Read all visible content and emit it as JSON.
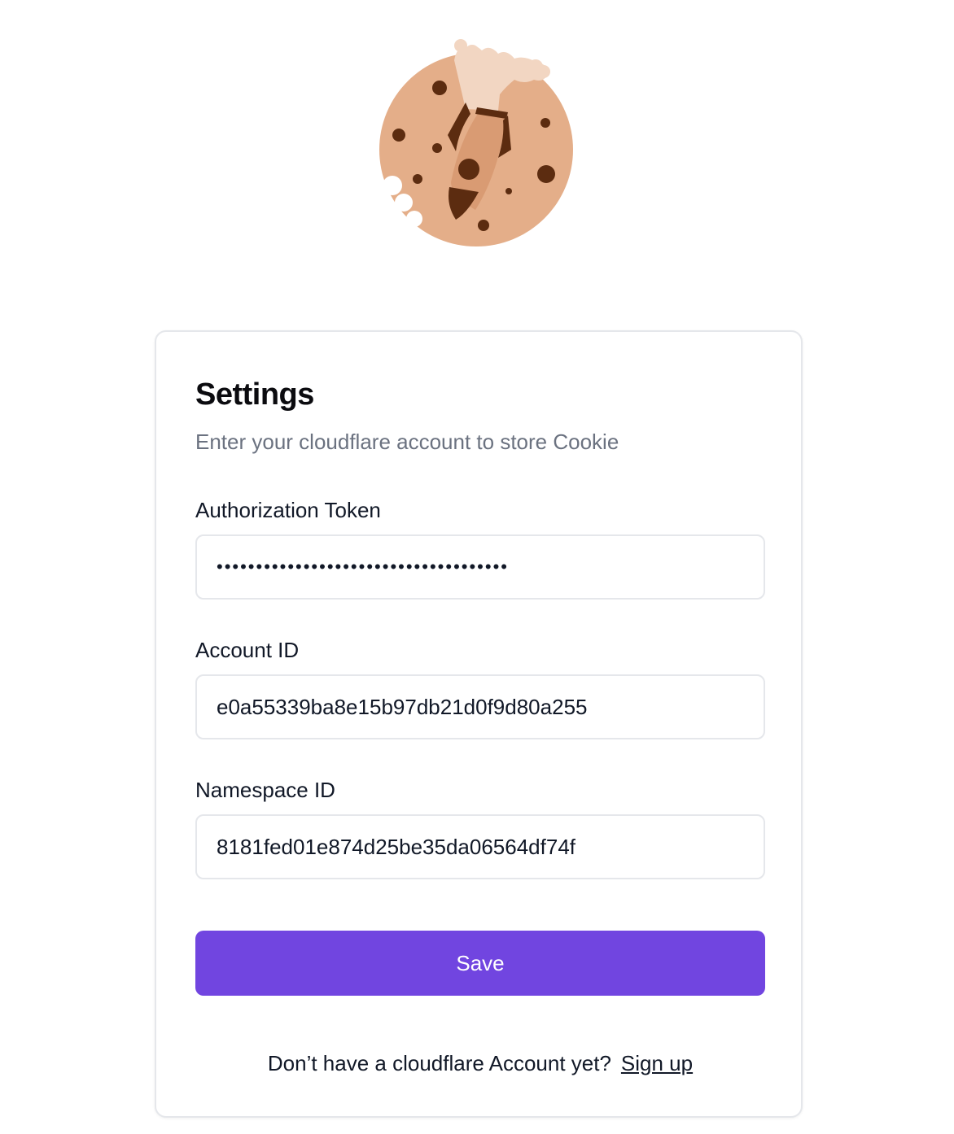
{
  "logo": {
    "icon": "cookie-rocket-logo",
    "colors": {
      "dough": "#e4ae89",
      "chip": "#5c2c10",
      "smoke": "#f2d6c2"
    }
  },
  "settings": {
    "title": "Settings",
    "subtitle": "Enter your cloudflare account to store Cookie",
    "authorization_token": {
      "label": "Authorization Token",
      "value": "•••••••••••••••••••••••••••••••••••••"
    },
    "account_id": {
      "label": "Account ID",
      "value": "e0a55339ba8e15b97db21d0f9d80a255"
    },
    "namespace_id": {
      "label": "Namespace ID",
      "value": "8181fed01e874d25be35da06564df74f"
    },
    "save_label": "Save",
    "footer": {
      "prompt": "Don’t have a cloudflare Account yet?",
      "signup_label": "Sign up"
    }
  },
  "colors": {
    "accent": "#7145e0",
    "border": "#e5e7eb",
    "muted_text": "#6b7280"
  }
}
